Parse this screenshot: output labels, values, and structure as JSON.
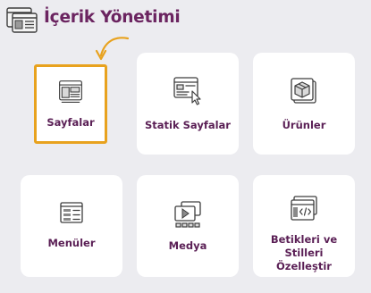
{
  "header": {
    "title": "İçerik Yönetimi",
    "icon": "content-window-icon"
  },
  "colors": {
    "title": "#6b2460",
    "label": "#5a1f55",
    "highlight": "#e8a21e",
    "background": "#ececf0",
    "card": "#ffffff"
  },
  "cards": [
    {
      "label": "Sayfalar",
      "icon": "pages-icon",
      "highlighted": true
    },
    {
      "label": "Statik Sayfalar",
      "icon": "static-page-cursor-icon",
      "highlighted": false
    },
    {
      "label": "Ürünler",
      "icon": "product-box-icon",
      "highlighted": false
    },
    {
      "label": "Menüler",
      "icon": "menu-list-icon",
      "highlighted": false
    },
    {
      "label": "Medya",
      "icon": "media-video-icon",
      "highlighted": false
    },
    {
      "label": "Betikleri ve Stilleri Özelleştir",
      "icon": "code-window-icon",
      "highlighted": false
    }
  ]
}
